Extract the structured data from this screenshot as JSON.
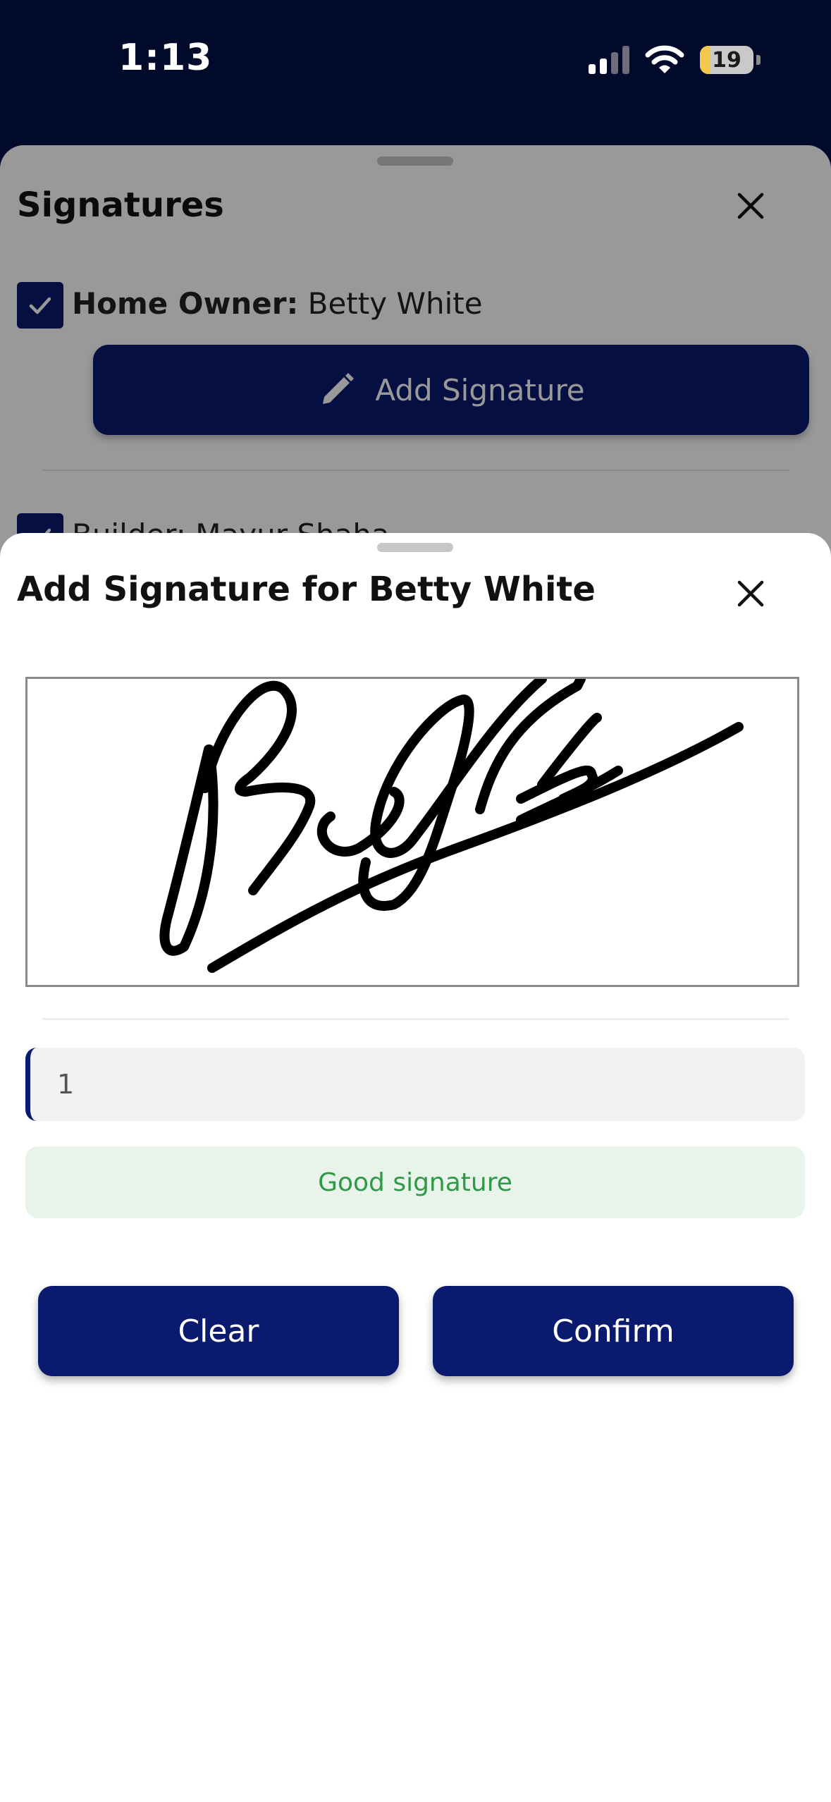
{
  "status_bar": {
    "time": "1:13",
    "battery_level": "19",
    "icons": [
      "cellular-signal-icon",
      "wifi-icon",
      "battery-icon"
    ]
  },
  "background_sheet": {
    "title": "Signatures",
    "close_icon": "close-icon",
    "owner": {
      "checked": true,
      "role": "Home Owner:",
      "name": "Betty White"
    },
    "add_signature_label": "Add Signature",
    "add_signature_icon": "pencil-icon",
    "builder_partial": "Builder: Mayur Shaha..."
  },
  "signature_sheet": {
    "title": "Add Signature for Betty White",
    "close_icon": "close-icon",
    "input_value": "1",
    "feedback_text": "Good signature",
    "clear_label": "Clear",
    "confirm_label": "Confirm"
  },
  "colors": {
    "status_bar_bg": "#020a2b",
    "primary": "#0a1a6e",
    "feedback_bg": "#e8f4ea",
    "feedback_text": "#2e9a46",
    "battery_fill": "#f4c84a"
  }
}
